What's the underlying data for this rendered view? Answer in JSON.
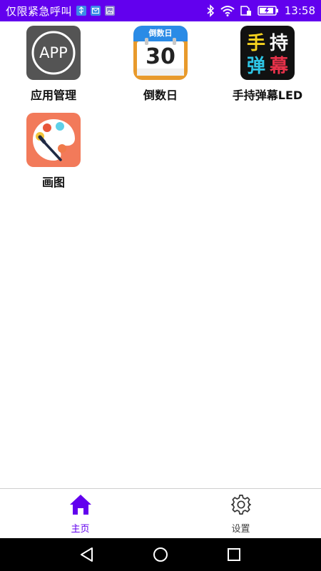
{
  "status_bar": {
    "carrier_text": "仅限紧急呼叫",
    "time": "13:58",
    "notification_icons": [
      "usb-icon",
      "mail-icon",
      "gallery-icon"
    ],
    "system_icons": [
      "bluetooth-icon",
      "wifi-icon",
      "sim-icon",
      "battery-icon"
    ]
  },
  "apps": [
    {
      "label": "应用管理",
      "icon": "app-management-icon",
      "icon_text": "APP"
    },
    {
      "label": "倒数日",
      "icon": "countdown-calendar-icon",
      "icon_header": "倒数日",
      "icon_number": "30"
    },
    {
      "label": "手持弹幕LED",
      "icon": "led-danmaku-icon",
      "icon_chars": [
        "手",
        "持",
        "弹",
        "幕"
      ]
    },
    {
      "label": "画图",
      "icon": "paint-palette-icon"
    }
  ],
  "bottom_nav": {
    "items": [
      {
        "label": "主页",
        "icon": "home-icon",
        "active": true
      },
      {
        "label": "设置",
        "icon": "settings-gear-icon",
        "active": false
      }
    ]
  },
  "colors": {
    "accent": "#6200ee",
    "status_bar": "#6200ee",
    "led_yellow": "#f5d21f",
    "led_cyan": "#2ec6e6",
    "led_red": "#e8324a",
    "palette_bg": "#f27a5a"
  }
}
